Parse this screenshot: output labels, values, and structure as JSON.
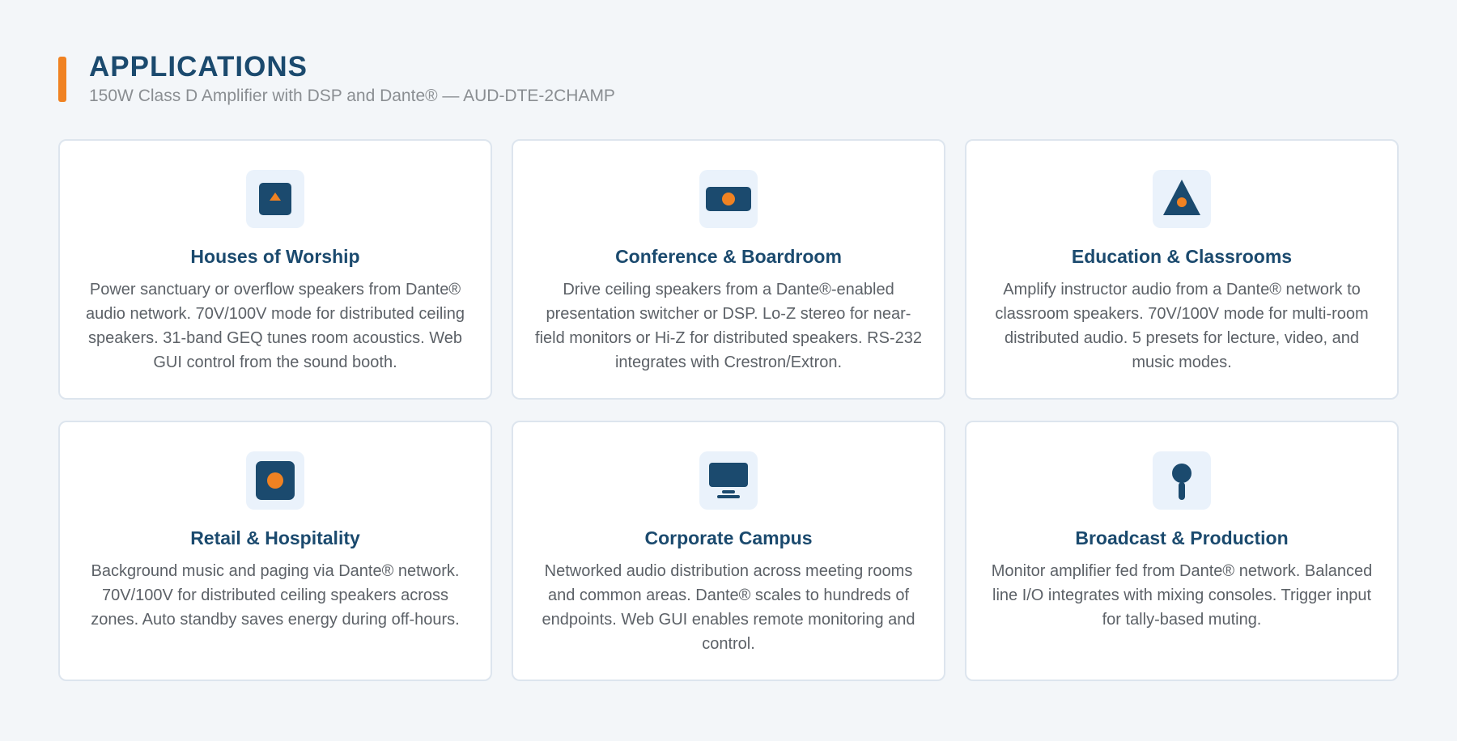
{
  "header": {
    "title": "APPLICATIONS",
    "subtitle": "150W Class D Amplifier with DSP and Dante® — AUD-DTE-2CHAMP"
  },
  "colors": {
    "accent": "#f08222",
    "brand": "#1b4a6e",
    "tile": "#eaf2fb"
  },
  "cards": [
    {
      "icon": "speaker-triangle-icon",
      "title": "Houses of Worship",
      "description": "Power sanctuary or overflow speakers from Dante® audio network. 70V/100V mode for distributed ceiling speakers. 31-band GEQ tunes room acoustics. Web GUI control from the sound booth."
    },
    {
      "icon": "soundbar-icon",
      "title": "Conference & Boardroom",
      "description": "Drive ceiling speakers from a Dante®-enabled presentation switcher or DSP. Lo-Z stereo for near-field monitors or Hi-Z for distributed speakers. RS-232 integrates with Crestron/Extron."
    },
    {
      "icon": "triangle-speaker-icon",
      "title": "Education & Classrooms",
      "description": "Amplify instructor audio from a Dante® network to classroom speakers. 70V/100V mode for multi-room distributed audio. 5 presets for lecture, video, and music modes."
    },
    {
      "icon": "speaker-circle-icon",
      "title": "Retail & Hospitality",
      "description": "Background music and paging via Dante® network. 70V/100V for distributed ceiling speakers across zones. Auto standby saves energy during off-hours."
    },
    {
      "icon": "monitor-icon",
      "title": "Corporate Campus",
      "description": "Networked audio distribution across meeting rooms and common areas. Dante® scales to hundreds of endpoints. Web GUI enables remote monitoring and control."
    },
    {
      "icon": "microphone-icon",
      "title": "Broadcast & Production",
      "description": "Monitor amplifier fed from Dante® network. Balanced line I/O integrates with mixing consoles. Trigger input for tally-based muting."
    }
  ]
}
